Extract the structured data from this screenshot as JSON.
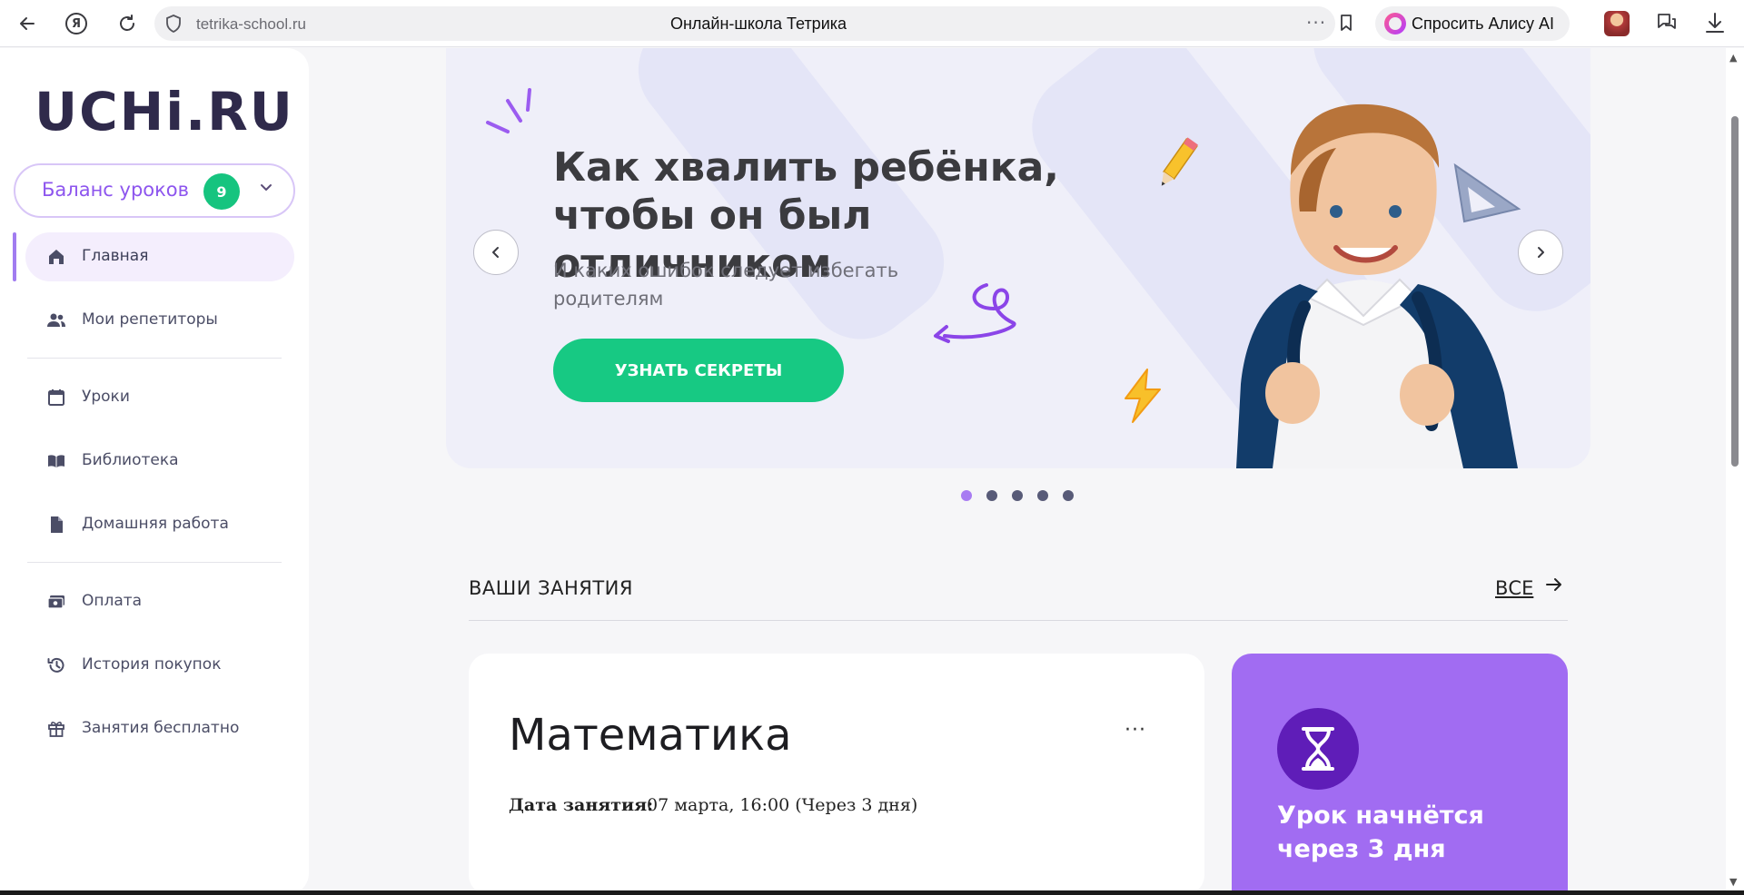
{
  "browser": {
    "url": "tetrika-school.ru",
    "tab_title": "Онлайн-школа Тетрика",
    "ya_label": "Я",
    "alice_label": "Спросить Алису AI",
    "more_label": "···"
  },
  "sidebar": {
    "logo": "UCHi.RU",
    "balance": {
      "label": "Баланс уроков",
      "count": "9"
    },
    "items": [
      {
        "label": "Главная",
        "icon": "home-icon",
        "active": true
      },
      {
        "label": "Мои репетиторы",
        "icon": "people-icon",
        "active": false
      },
      {
        "label": "Уроки",
        "icon": "calendar-icon",
        "active": false
      },
      {
        "label": "Библиотека",
        "icon": "book-icon",
        "active": false
      },
      {
        "label": "Домашняя работа",
        "icon": "document-icon",
        "active": false
      },
      {
        "label": "Оплата",
        "icon": "payment-icon",
        "active": false
      },
      {
        "label": "История покупок",
        "icon": "history-icon",
        "active": false
      },
      {
        "label": "Занятия бесплатно",
        "icon": "gift-icon",
        "active": false
      }
    ]
  },
  "banner": {
    "title": "Как хвалить ребёнка, чтобы он был отличником",
    "subtitle": "И каких ошибок следует избегать родителям",
    "cta": "УЗНАТЬ СЕКРЕТЫ",
    "slides_total": 5,
    "active_slide": 1
  },
  "sessions": {
    "title": "ВАШИ ЗАНЯТИЯ",
    "all_link": "ВСЕ",
    "lesson": {
      "subject": "Математика",
      "date_label": "Дата занятия:",
      "date_value": "07 марта, 16:00 (Через 3 дня)",
      "menu_label": "···"
    },
    "countdown": {
      "title": "Урок начнётся через 3 дня"
    }
  },
  "colors": {
    "accent_purple": "#a16cf2",
    "green": "#17c983",
    "balance_text": "#8d55ee"
  }
}
